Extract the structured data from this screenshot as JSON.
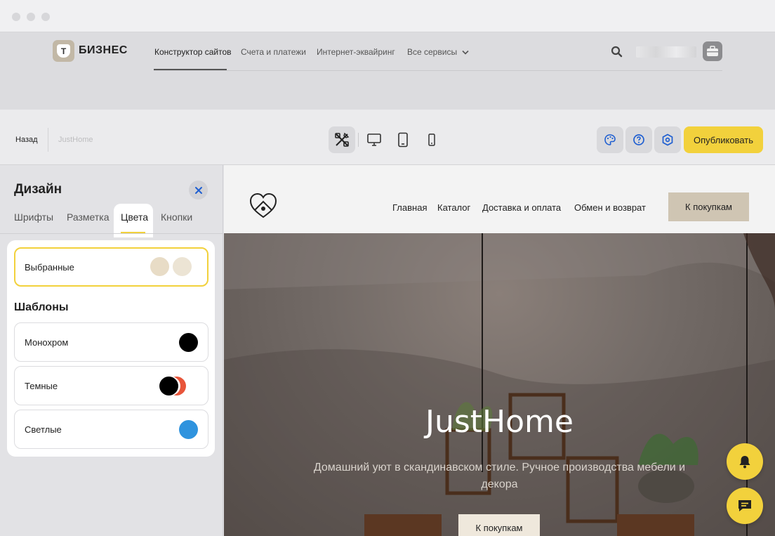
{
  "brand": {
    "logo_letter": "Т",
    "name": "БИЗНЕС"
  },
  "nav": {
    "items": [
      {
        "label": "Конструктор сайтов"
      },
      {
        "label": "Счета и платежи"
      },
      {
        "label": "Интернет-эквайринг"
      },
      {
        "label": "Все сервисы"
      }
    ]
  },
  "toolbar": {
    "back_label": "Назад",
    "site_name": "JustHome",
    "publish_label": "Опубликовать"
  },
  "panel": {
    "title": "Дизайн",
    "tabs": [
      {
        "label": "Шрифты"
      },
      {
        "label": "Разметка"
      },
      {
        "label": "Цвета"
      },
      {
        "label": "Кнопки"
      }
    ],
    "active_tab": "Цвета",
    "selected_option": {
      "label": "Выбранные",
      "colors": [
        "#e8dcc6",
        "#ece4d4"
      ]
    },
    "templates_title": "Шаблоны",
    "templates": [
      {
        "label": "Монохром",
        "colors": [
          "#000000"
        ]
      },
      {
        "label": "Темные",
        "colors": [
          "#000000",
          "#e8553a"
        ]
      },
      {
        "label": "Светлые",
        "colors": [
          "#2f93de"
        ]
      }
    ]
  },
  "preview": {
    "nav": [
      {
        "label": "Главная"
      },
      {
        "label": "Каталог"
      },
      {
        "label": "Доставка и оплата"
      },
      {
        "label": "Обмен и возврат"
      }
    ],
    "cta_label": "К покупкам",
    "hero_title": "JustHome",
    "hero_subtitle": "Домашний уют в скандинавском стиле. Ручное производства мебели и декора",
    "hero_button": "К покупкам"
  },
  "colors": {
    "accent": "#f2d13c",
    "selected_border": "#f2d13c",
    "icon_blue": "#1f5fd1"
  }
}
